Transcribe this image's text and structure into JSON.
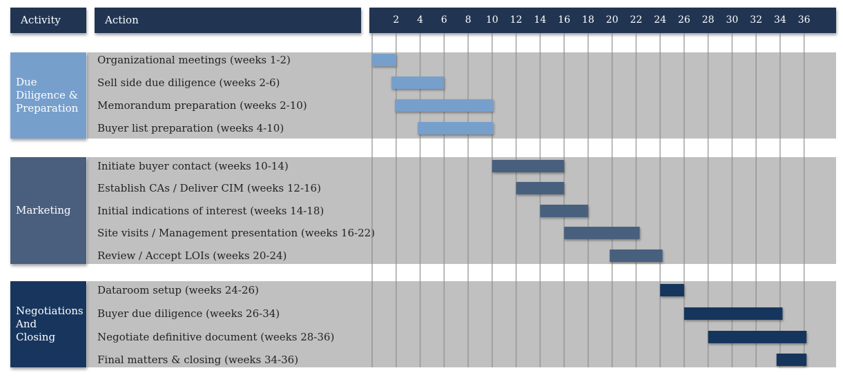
{
  "header": {
    "activity_label": "Activity",
    "action_label": "Action"
  },
  "colors": {
    "header_bg": "#213553",
    "band_bg": "#c0c0c0",
    "due_diligence": "#779fcc",
    "marketing": "#4a5f7e",
    "negotiations": "#18365d",
    "gridline": "#8c8c8c"
  },
  "chart_data": {
    "type": "gantt",
    "title": "",
    "x_unit": "weeks",
    "x_ticks": [
      "2",
      "4",
      "6",
      "8",
      "10",
      "12",
      "14",
      "16",
      "18",
      "20",
      "22",
      "24",
      "26",
      "28",
      "30",
      "32",
      "34",
      "36"
    ],
    "xlim": [
      0,
      37
    ],
    "groups": [
      {
        "name": "Due Diligence & Preparation",
        "label": "Due\nDiligence &\nPreparation",
        "color": "#779fcc",
        "tasks": [
          {
            "label": "Organizational meetings (weeks 1-2)",
            "start": 0,
            "end": 2
          },
          {
            "label": "Sell side due diligence (weeks 2-6)",
            "start": 1.6,
            "end": 6
          },
          {
            "label": "Memorandum preparation (weeks 2-10)",
            "start": 1.9,
            "end": 10.1
          },
          {
            "label": "Buyer list preparation (weeks 4-10)",
            "start": 3.8,
            "end": 10.1
          }
        ]
      },
      {
        "name": "Marketing",
        "label": "Marketing",
        "color": "#4a5f7e",
        "tasks": [
          {
            "label": "Initiate buyer contact (weeks 10-14)",
            "start": 10,
            "end": 16
          },
          {
            "label": "Establish CAs / Deliver CIM (weeks 12-16)",
            "start": 12,
            "end": 16
          },
          {
            "label": "Initial indications of interest (weeks 14-18)",
            "start": 14,
            "end": 18
          },
          {
            "label": "Site visits / Management presentation (weeks 16-22)",
            "start": 16,
            "end": 22.3
          },
          {
            "label": "Review / Accept LOIs (weeks 20-24)",
            "start": 19.8,
            "end": 24.2
          }
        ]
      },
      {
        "name": "Negotiations And Closing",
        "label": "Negotiations\nAnd\nClosing",
        "color": "#18365d",
        "tasks": [
          {
            "label": "Dataroom setup (weeks 24-26)",
            "start": 24,
            "end": 26
          },
          {
            "label": "Buyer due diligence (weeks 26-34)",
            "start": 26,
            "end": 34.2
          },
          {
            "label": "Negotiate definitive document (weeks 28-36)",
            "start": 28,
            "end": 36.2
          },
          {
            "label": "Final matters & closing (weeks 34-36)",
            "start": 33.7,
            "end": 36.2
          }
        ]
      }
    ]
  }
}
